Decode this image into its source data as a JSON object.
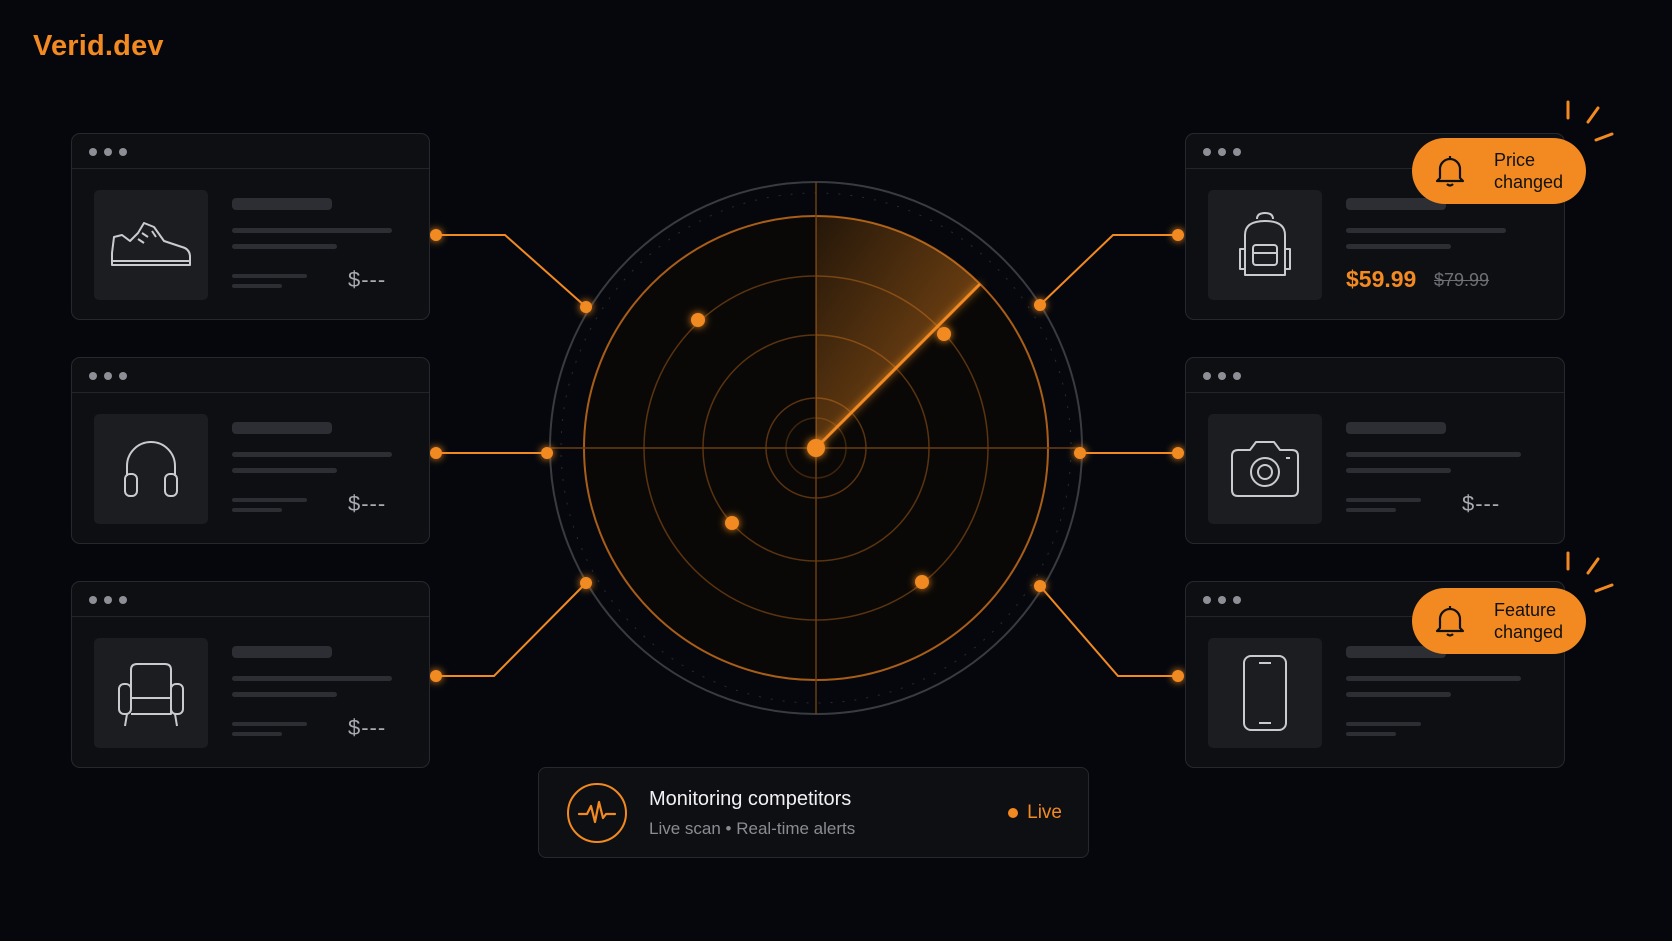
{
  "brand": {
    "name": "Verid.dev"
  },
  "colors": {
    "accent": "#f28a21",
    "background": "#05070d",
    "card": "#0e0f13"
  },
  "left_cards": [
    {
      "icon": "sneaker-icon",
      "price": "$---"
    },
    {
      "icon": "headphones-icon",
      "price": "$---"
    },
    {
      "icon": "armchair-icon",
      "price": "$---"
    }
  ],
  "right_cards": [
    {
      "icon": "backpack-icon",
      "price_new": "$59.99",
      "price_old": "$79.99",
      "badge": {
        "icon": "bell-icon",
        "line1": "Price",
        "line2": "changed"
      }
    },
    {
      "icon": "camera-icon",
      "price": "$---"
    },
    {
      "icon": "smartphone-icon",
      "badge": {
        "icon": "bell-icon",
        "line1": "Feature",
        "line2": "changed"
      }
    }
  ],
  "radar": {
    "icon": "radar-sweep"
  },
  "status": {
    "icon": "heartbeat-icon",
    "title": "Monitoring competitors",
    "subtitle": "Live scan • Real-time alerts",
    "live_label": "Live"
  }
}
